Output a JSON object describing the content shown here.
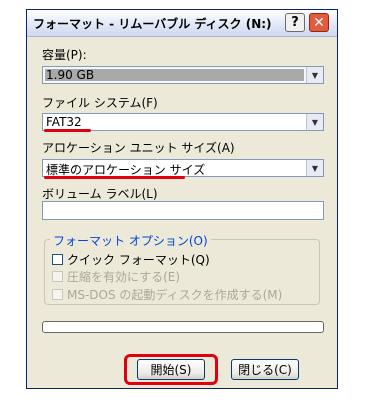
{
  "window": {
    "title": "フォーマット - リムーバブル ディスク (N:)",
    "help_glyph": "?",
    "close_glyph": "✕"
  },
  "capacity": {
    "label": "容量(P):",
    "value": "1.90 GB"
  },
  "file_system": {
    "label": "ファイル システム(F)",
    "value": "FAT32"
  },
  "allocation_unit": {
    "label": "アロケーション ユニット サイズ(A)",
    "value": "標準のアロケーション サイズ"
  },
  "volume_label": {
    "label": "ボリューム ラベル(L)",
    "value": ""
  },
  "format_options": {
    "title": "フォーマット オプション(O)",
    "items": [
      {
        "label": "クイック フォーマット(Q)",
        "checked": false,
        "enabled": true
      },
      {
        "label": "圧縮を有効にする(E)",
        "checked": false,
        "enabled": false
      },
      {
        "label": "MS-DOS の起動ディスクを作成する(M)",
        "checked": false,
        "enabled": false
      }
    ]
  },
  "progress": {
    "value": 0
  },
  "buttons": {
    "start": "開始(S)",
    "close": "閉じる(C)"
  },
  "annotation_color": "#e00010",
  "icons": {
    "dropdown": "chevron-down-icon",
    "help": "help-icon",
    "close": "close-icon"
  }
}
